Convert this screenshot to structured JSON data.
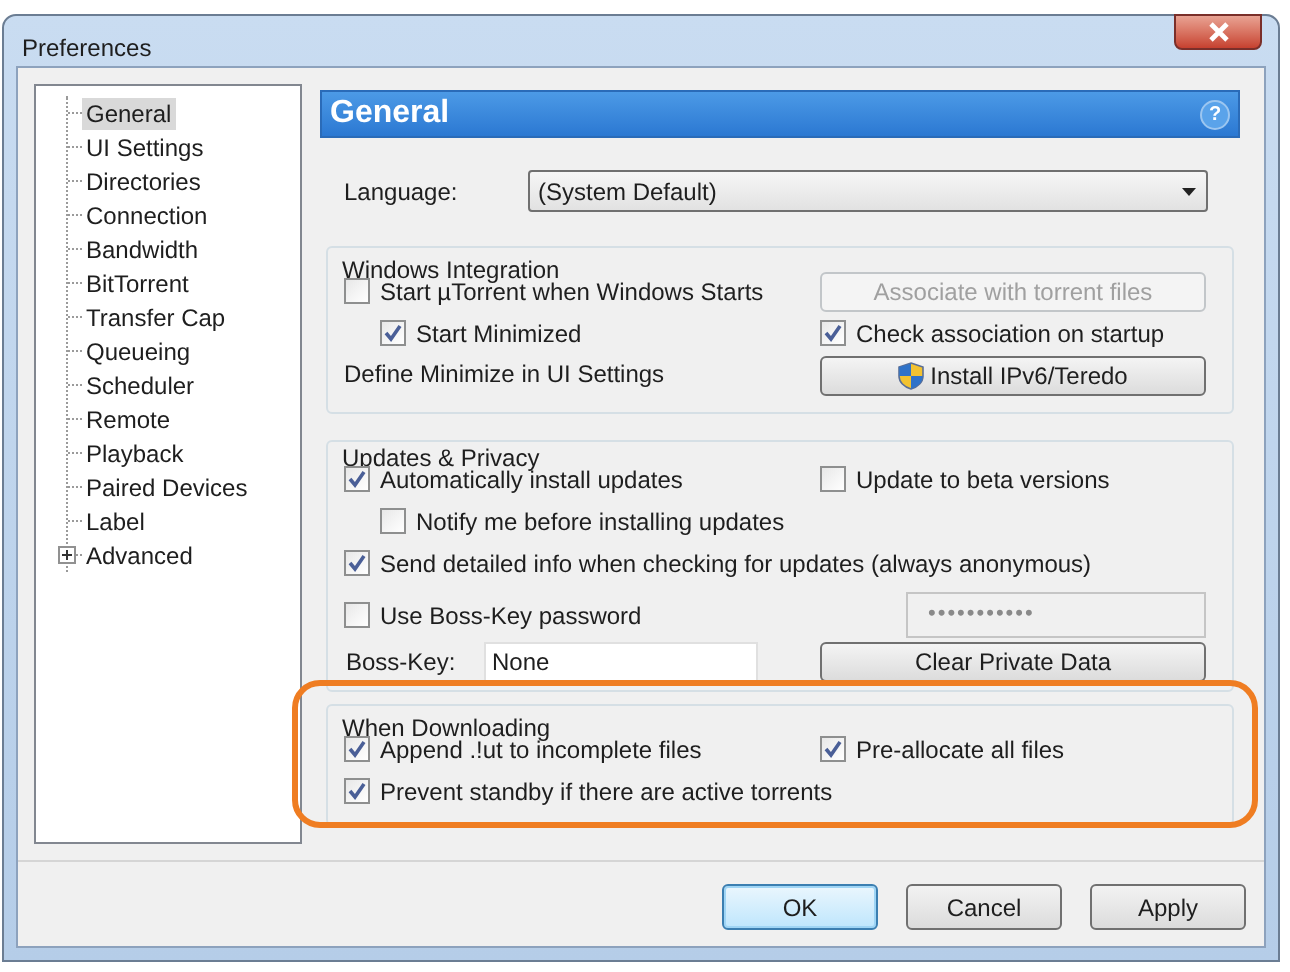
{
  "window": {
    "title": "Preferences"
  },
  "sidebar": {
    "items": [
      {
        "label": "General",
        "kind": "leaf",
        "selected": true
      },
      {
        "label": "UI Settings",
        "kind": "leaf",
        "selected": false
      },
      {
        "label": "Directories",
        "kind": "leaf",
        "selected": false
      },
      {
        "label": "Connection",
        "kind": "leaf",
        "selected": false
      },
      {
        "label": "Bandwidth",
        "kind": "leaf",
        "selected": false
      },
      {
        "label": "BitTorrent",
        "kind": "leaf",
        "selected": false
      },
      {
        "label": "Transfer Cap",
        "kind": "leaf",
        "selected": false
      },
      {
        "label": "Queueing",
        "kind": "leaf",
        "selected": false
      },
      {
        "label": "Scheduler",
        "kind": "leaf",
        "selected": false
      },
      {
        "label": "Remote",
        "kind": "leaf",
        "selected": false
      },
      {
        "label": "Playback",
        "kind": "leaf",
        "selected": false
      },
      {
        "label": "Paired Devices",
        "kind": "leaf",
        "selected": false
      },
      {
        "label": "Label",
        "kind": "leaf",
        "selected": false
      },
      {
        "label": "Advanced",
        "kind": "folder",
        "selected": false
      }
    ]
  },
  "panel": {
    "title": "General",
    "help_icon": "?",
    "language": {
      "label": "Language:",
      "value": "(System Default)"
    },
    "windows_integration": {
      "title": "Windows Integration",
      "start_with_windows": {
        "label": "Start µTorrent when Windows Starts",
        "checked": false,
        "children": [
          {
            "label": "Start Minimized",
            "checked": true
          }
        ]
      },
      "note": "Define Minimize in UI Settings",
      "associate_button": {
        "label": "Associate with torrent files",
        "disabled": true
      },
      "check_association": {
        "label": "Check association on startup",
        "checked": true
      },
      "install_button": {
        "label": "Install IPv6/Teredo",
        "disabled": false
      }
    },
    "updates_privacy": {
      "title": "Updates & Privacy",
      "auto_install": {
        "label": "Automatically install updates",
        "checked": true,
        "children": [
          {
            "label": "Notify me before installing updates",
            "checked": false
          }
        ]
      },
      "beta": {
        "label": "Update to beta versions",
        "checked": false
      },
      "send_info": {
        "label": "Send detailed info when checking for updates (always anonymous)",
        "checked": true
      },
      "boss_key_password": {
        "label": "Use Boss-Key password",
        "checked": false
      },
      "password_field": {
        "value": "•••••••••••",
        "disabled": true
      },
      "boss_key": {
        "label": "Boss-Key:",
        "value": "None"
      },
      "clear_button": {
        "label": "Clear Private Data",
        "disabled": false
      }
    },
    "when_downloading": {
      "title": "When Downloading",
      "highlighted": true,
      "append": {
        "label": "Append .!ut to incomplete files",
        "checked": true
      },
      "preallocate": {
        "label": "Pre-allocate all files",
        "checked": true
      },
      "prevent_standby": {
        "label": "Prevent standby if there are active torrents",
        "checked": true
      }
    }
  },
  "buttons": [
    {
      "label": "OK",
      "default": true
    },
    {
      "label": "Cancel",
      "default": false
    },
    {
      "label": "Apply",
      "default": false
    }
  ]
}
